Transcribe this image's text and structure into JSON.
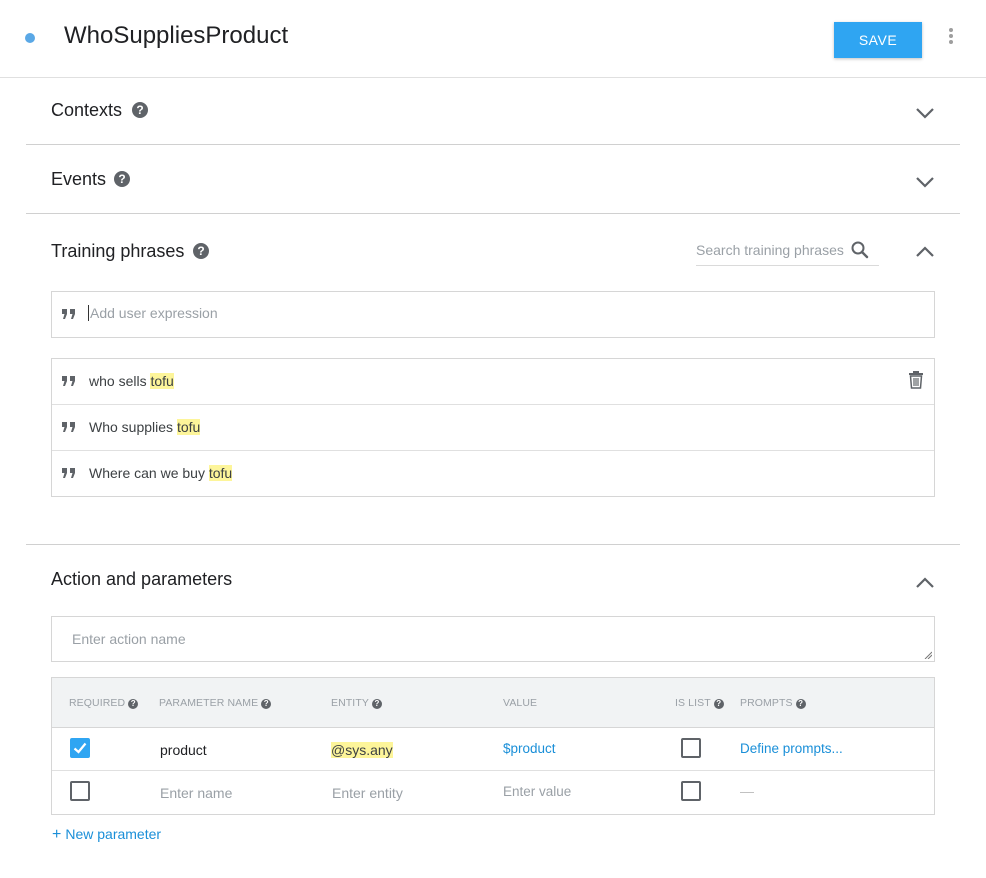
{
  "header": {
    "title": "WhoSuppliesProduct",
    "save_label": "SAVE"
  },
  "sections": {
    "contexts": {
      "label": "Contexts"
    },
    "events": {
      "label": "Events"
    },
    "training": {
      "label": "Training phrases",
      "search_placeholder": "Search training phrases",
      "add_placeholder": "Add user expression",
      "phrases": [
        {
          "before": "who sells ",
          "highlight": "tofu"
        },
        {
          "before": "Who supplies ",
          "highlight": "tofu"
        },
        {
          "before": "Where can we buy ",
          "highlight": "tofu"
        }
      ]
    },
    "action": {
      "label": "Action and parameters",
      "action_placeholder": "Enter action name"
    }
  },
  "params": {
    "columns": {
      "required": "REQUIRED",
      "name": "PARAMETER NAME",
      "entity": "ENTITY",
      "value": "VALUE",
      "is_list": "IS LIST",
      "prompts": "PROMPTS"
    },
    "rows": [
      {
        "required": true,
        "name": "product",
        "entity": "@sys.any",
        "value": "$product",
        "is_list": false,
        "prompts": "Define prompts..."
      }
    ],
    "new_row": {
      "name_placeholder": "Enter name",
      "entity_placeholder": "Enter entity",
      "value_placeholder": "Enter value",
      "prompts": "—"
    },
    "new_param_label": "New parameter"
  },
  "colors": {
    "accent": "#2fa5f2",
    "link": "#1a8fd8",
    "highlight": "#fdf59a",
    "status_dot": "#5aa8e6"
  },
  "icons": [
    "help-icon",
    "chevron-down-icon",
    "chevron-up-icon",
    "search-icon",
    "quote-icon",
    "trash-icon",
    "more-vert-icon",
    "check-icon",
    "plus-icon"
  ]
}
